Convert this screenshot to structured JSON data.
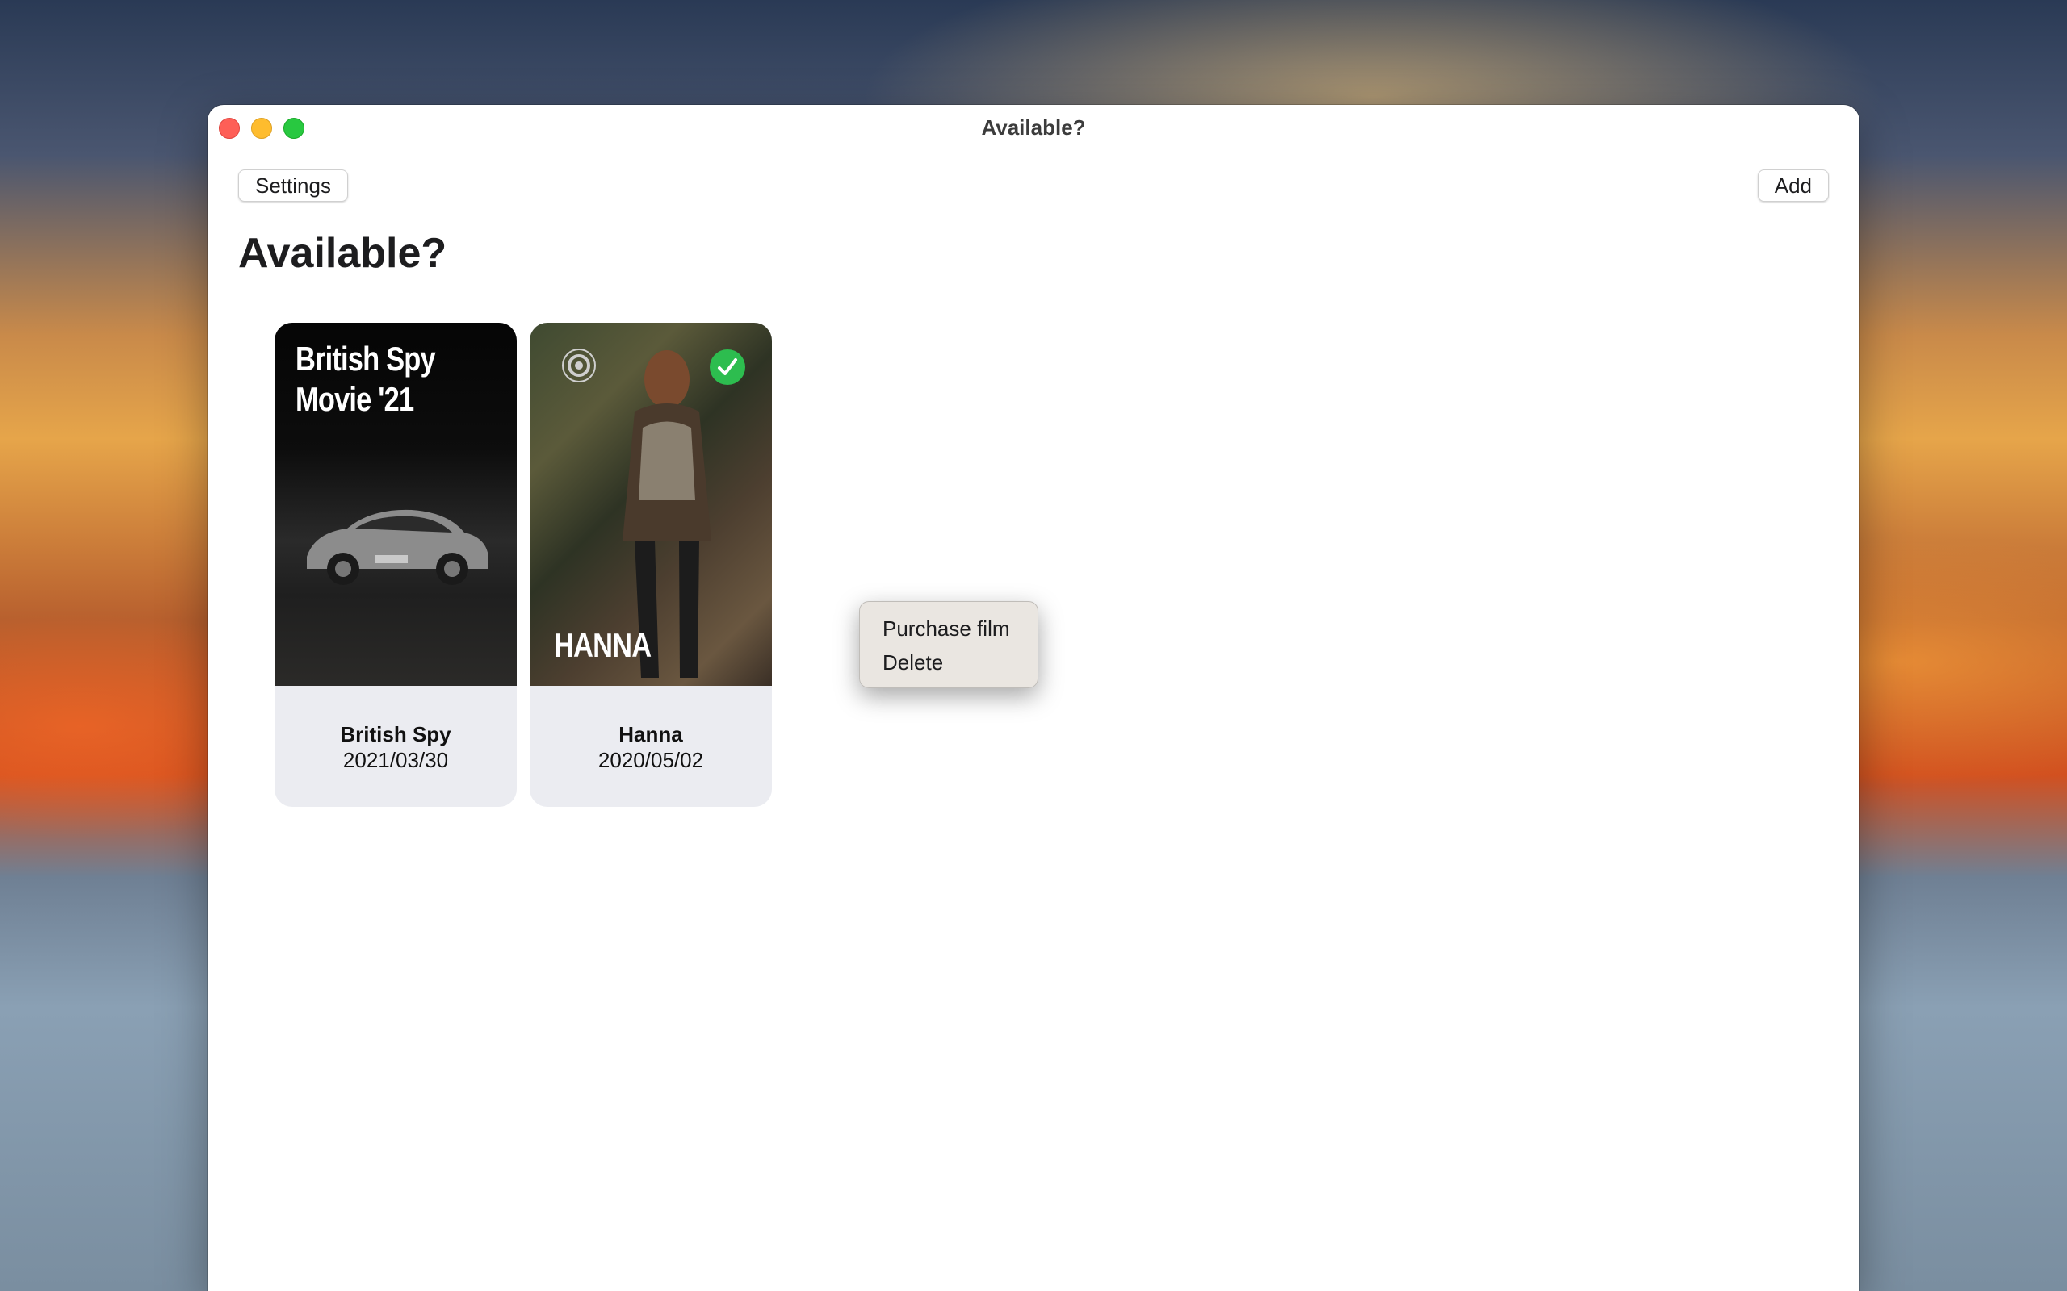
{
  "window": {
    "title": "Available?"
  },
  "toolbar": {
    "settings_label": "Settings",
    "add_label": "Add"
  },
  "page": {
    "heading": "Available?"
  },
  "films": [
    {
      "poster_title_line1": "British Spy",
      "poster_title_line2": "Movie '21",
      "name": "British Spy",
      "date": "2021/03/30",
      "available": false
    },
    {
      "poster_title": "HANNA",
      "name": "Hanna",
      "date": "2020/05/02",
      "available": true
    }
  ],
  "context_menu": {
    "items": [
      "Purchase film",
      "Delete"
    ]
  },
  "icons": {
    "status": "checkmark-circle-icon",
    "tracking": "target-icon"
  },
  "colors": {
    "check_green": "#2dbd4f",
    "card_bg": "#ebecf1"
  }
}
